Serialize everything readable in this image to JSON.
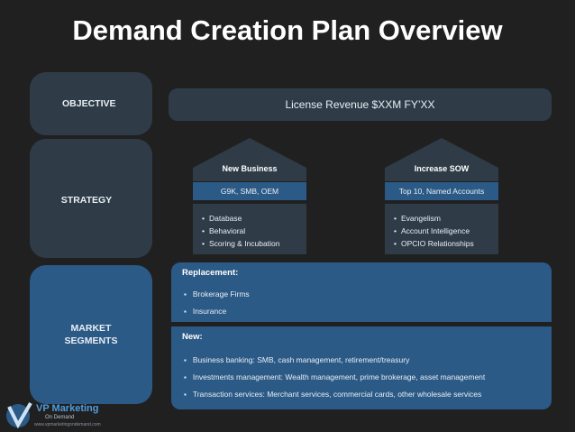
{
  "title": "Demand Creation Plan Overview",
  "sidebar": {
    "objective": "OBJECTIVE",
    "strategy": "STRATEGY",
    "market_line1": "MARKET",
    "market_line2": "SEGMENTS"
  },
  "objective": {
    "text": "License Revenue $XXM FY’XX"
  },
  "strategies": [
    {
      "roof_label": "New Business",
      "subtitle": "G9K, SMB, OEM",
      "items": [
        "Database",
        "Behavioral",
        "Scoring & Incubation"
      ]
    },
    {
      "roof_label": "Increase SOW",
      "subtitle": "Top 10, Named Accounts",
      "items": [
        "Evangelism",
        "Account Intelligence",
        "OPCIO Relationships"
      ]
    }
  ],
  "segments": {
    "replacement": {
      "title": "Replacement:",
      "items": [
        "Brokerage Firms",
        "Insurance"
      ]
    },
    "new": {
      "title": "New:",
      "items": [
        "Business banking: SMB, cash management, retirement/treasury",
        "Investments management: Wealth management, prime brokerage, asset management",
        "Transaction  services: Merchant services, commercial cards, other wholesale services"
      ]
    }
  },
  "logo": {
    "name": "VP Marketing",
    "sub": "On Demand",
    "sub2": "www.vpmarketingondemand.com"
  },
  "colors": {
    "background": "#202020",
    "dark_panel": "#2f3c48",
    "blue_panel": "#2c5a86"
  }
}
